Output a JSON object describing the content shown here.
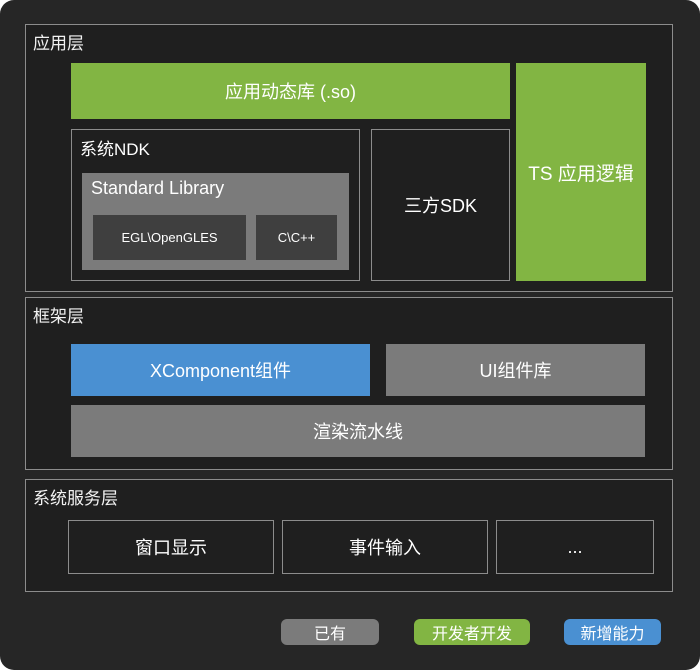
{
  "app_layer": {
    "title": "应用层",
    "dynamic_lib": "应用动态库 (.so)",
    "ts_logic": "TS 应用逻辑",
    "ndk": {
      "title": "系统NDK",
      "std_lib": {
        "title": "Standard Library",
        "items": [
          "EGL\\OpenGLES",
          "C\\C++"
        ]
      }
    },
    "third_party_sdk": "三方SDK"
  },
  "framework_layer": {
    "title": "框架层",
    "xcomponent": "XComponent组件",
    "ui_lib": "UI组件库",
    "render_pipeline": "渲染流水线"
  },
  "system_service_layer": {
    "title": "系统服务层",
    "items": [
      "窗口显示",
      "事件输入",
      "..."
    ]
  },
  "legend": {
    "existing": "已有",
    "developer": "开发者开发",
    "new": "新增能力"
  },
  "colors": {
    "developer": "#82b543",
    "new": "#4a90d2",
    "existing": "#7b7b7b"
  }
}
